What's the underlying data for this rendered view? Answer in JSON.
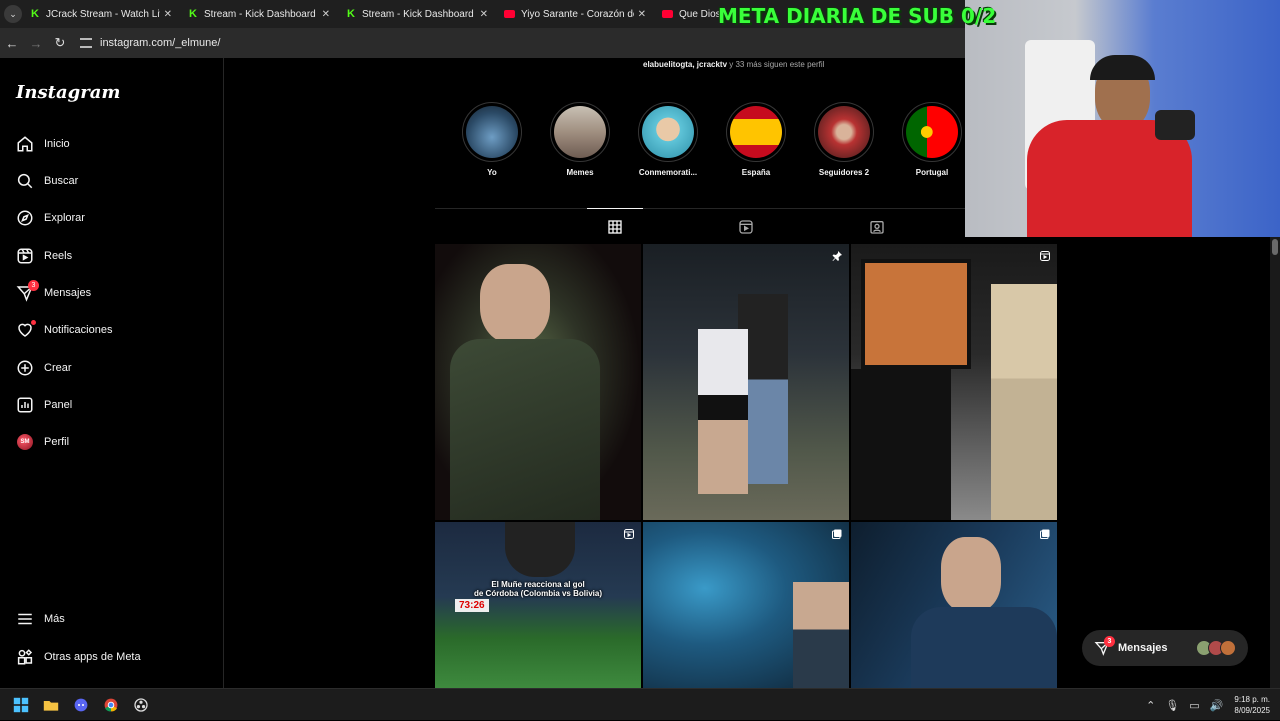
{
  "browser": {
    "tabs": [
      {
        "title": "JCrack Stream - Watch Live on Kick",
        "favicon": "kick-icon"
      },
      {
        "title": "Stream - Kick Dashboard",
        "favicon": "kick-icon"
      },
      {
        "title": "Stream - Kick Dashboard",
        "favicon": "kick-icon"
      },
      {
        "title": "Yiyo Sarante - Corazón de Acero",
        "favicon": "youtube-icon"
      },
      {
        "title": "Que Dios T",
        "favicon": "youtube-icon"
      }
    ],
    "url": "instagram.com/_elmune/"
  },
  "stream_overlay": {
    "goal_text": "META DIARIA DE SUB 0/2"
  },
  "sidebar": {
    "logo": "Instagram",
    "items": [
      {
        "label": "Inicio",
        "icon": "home-icon"
      },
      {
        "label": "Buscar",
        "icon": "search-icon"
      },
      {
        "label": "Explorar",
        "icon": "compass-icon"
      },
      {
        "label": "Reels",
        "icon": "reels-icon"
      },
      {
        "label": "Mensajes",
        "icon": "messenger-icon",
        "badge": "3"
      },
      {
        "label": "Notificaciones",
        "icon": "heart-icon"
      },
      {
        "label": "Crear",
        "icon": "plus-square-icon"
      },
      {
        "label": "Panel",
        "icon": "dashboard-icon"
      },
      {
        "label": "Perfil",
        "icon": "profile-avatar"
      }
    ],
    "more": "Más",
    "meta_apps": "Otras apps de Meta"
  },
  "profile": {
    "followed_by_users": "elabuelitogta, jcracktv",
    "followed_by_rest": " y 33 más siguen este perfil",
    "highlights": [
      {
        "label": "Yo",
        "color": "#3b6f9a"
      },
      {
        "label": "Memes",
        "color": "#9a8878"
      },
      {
        "label": "Conmemorati...",
        "color": "#5fc4d8"
      },
      {
        "label": "España",
        "color": "#c60b1e"
      },
      {
        "label": "Seguidores 2",
        "color": "#7a2a2a"
      },
      {
        "label": "Portugal",
        "color": "#006600"
      }
    ],
    "content_tabs": [
      {
        "name": "posts",
        "icon": "grid-icon",
        "active": true
      },
      {
        "name": "reels",
        "icon": "reels-icon",
        "active": false
      },
      {
        "name": "tagged",
        "icon": "tagged-icon",
        "active": false
      }
    ],
    "posts": [
      {
        "name": "post-1",
        "badge": ""
      },
      {
        "name": "post-2",
        "badge": "pin-icon"
      },
      {
        "name": "post-3",
        "badge": "reel-icon"
      },
      {
        "name": "post-4",
        "badge": "reel-icon",
        "caption_line1": "El Muñe reacciona al gol",
        "caption_line2": "de Córdoba (Colombia vs Bolivia)",
        "timer": "73:26"
      },
      {
        "name": "post-5",
        "badge": "carousel-icon"
      },
      {
        "name": "post-6",
        "badge": "carousel-icon"
      }
    ]
  },
  "messages_pill": {
    "label": "Mensajes",
    "badge": "3"
  },
  "taskbar": {
    "time": "9:18 p. m.",
    "date": "8/09/2025"
  }
}
